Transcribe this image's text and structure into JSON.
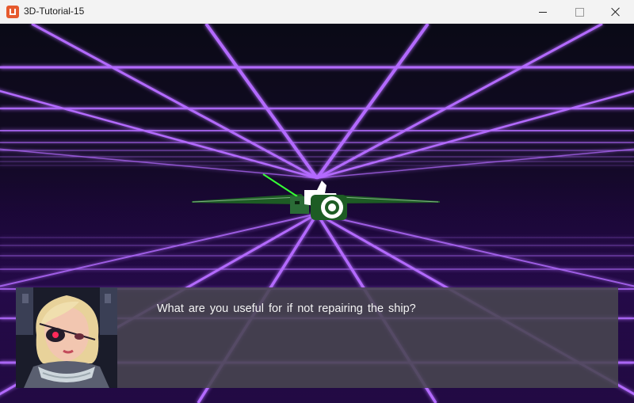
{
  "window": {
    "title": "3D-Tutorial-15",
    "app_icon": "monogame-icon",
    "controls": [
      "minimize-icon",
      "maximize-icon",
      "close-icon"
    ]
  },
  "scene": {
    "background": "synthwave-neon-grid",
    "grid_color": "#b36bff",
    "player_ship": {
      "colors": {
        "wing": "#1d5c24",
        "hull": "#ffffff",
        "cockpit": "#2a6b36",
        "laser": "#36ff36"
      }
    }
  },
  "dialog": {
    "speaker_portrait": "eyepatch-pilot-portrait",
    "text": "What are you useful for if not repairing the ship?"
  }
}
